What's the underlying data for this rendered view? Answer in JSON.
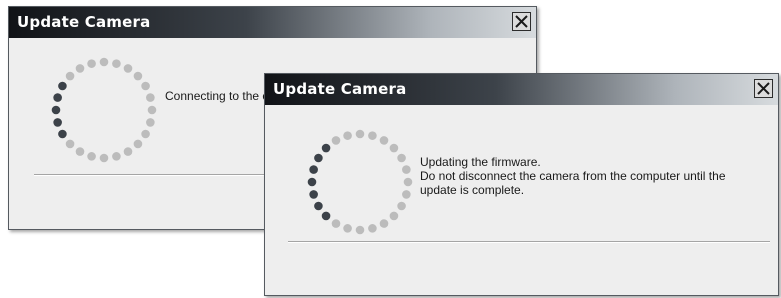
{
  "back_dialog": {
    "title": "Update Camera",
    "message": "Connecting to the camera..."
  },
  "front_dialog": {
    "title": "Update Camera",
    "message_line1": "Updating the firmware.",
    "message_line2": "Do not disconnect the camera from the computer until the",
    "message_line3": "update is complete."
  },
  "icons": {
    "close": "close-icon",
    "spinner": "spinner-icon"
  },
  "colors": {
    "dot_dark": "#3c4249",
    "dot_light": "#bcbcbc",
    "dialog_bg": "#eeeeee"
  }
}
